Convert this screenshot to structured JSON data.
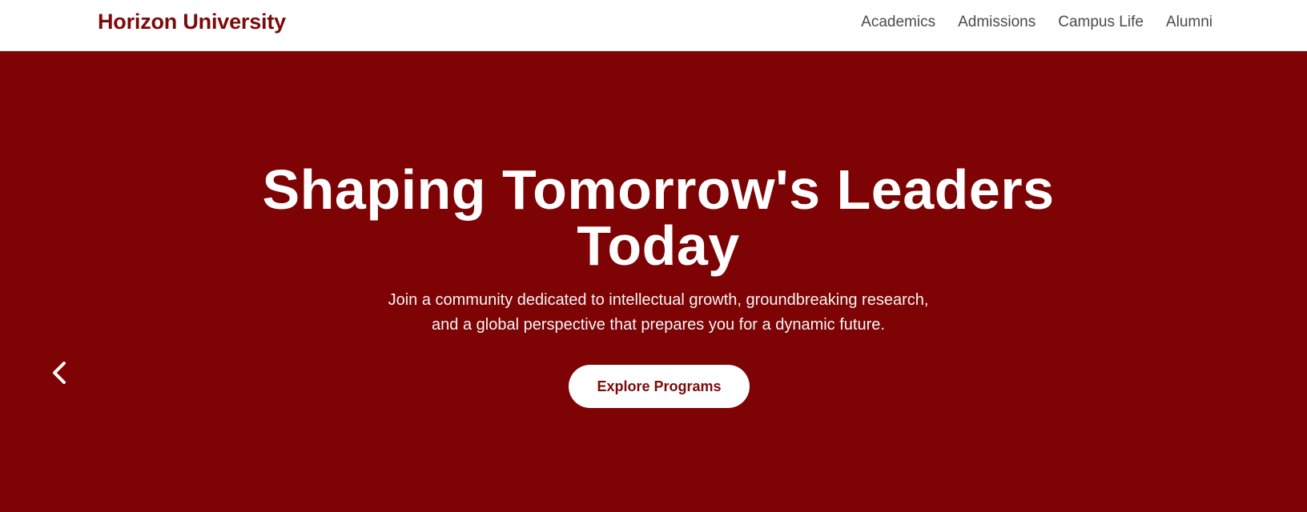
{
  "header": {
    "brand": "Horizon University",
    "nav": [
      "Academics",
      "Admissions",
      "Campus Life",
      "Alumni"
    ]
  },
  "hero": {
    "title_line1": "Shaping Tomorrow's Leaders",
    "title_line2": "Today",
    "subtitle_line1": "Join a community dedicated to intellectual growth, groundbreaking research,",
    "subtitle_line2": "and a global perspective that prepares you for a dynamic future.",
    "cta_label": "Explore Programs",
    "prev_icon": "chevron-left-icon"
  },
  "colors": {
    "brand": "#7d0a0a",
    "hero_bg": "#7d0305",
    "nav_text": "#4a4a4a"
  }
}
